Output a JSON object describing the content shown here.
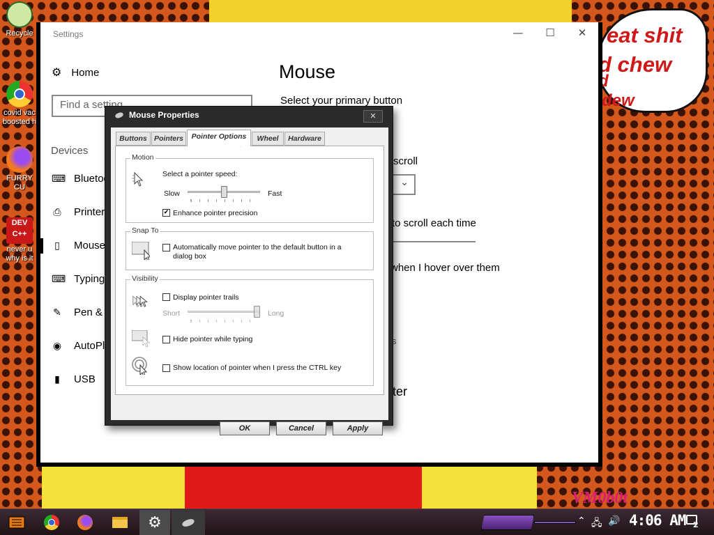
{
  "desktop": {
    "icons": [
      {
        "label": "Recycle"
      },
      {
        "label": "covid vac boosted h"
      },
      {
        "label": "FURRY CU"
      },
      {
        "label": "never u why is it"
      }
    ],
    "speech_bubble": [
      "eat shit",
      "d chew",
      "d",
      "dew"
    ],
    "signature": "VM0b0t"
  },
  "settings": {
    "title": "Settings",
    "controls": {
      "minimize": "—",
      "maximize": "☐",
      "close": "✕"
    },
    "home": "Home",
    "search_placeholder": "Find a setting",
    "section": "Devices",
    "nav": [
      {
        "label": "Bluetooth & other devices",
        "icon": "bluetooth-icon"
      },
      {
        "label": "Printers & scanners",
        "icon": "printer-icon"
      },
      {
        "label": "Mouse",
        "icon": "mouse-icon"
      },
      {
        "label": "Typing",
        "icon": "keyboard-icon"
      },
      {
        "label": "Pen & Windows Ink",
        "icon": "pen-icon"
      },
      {
        "label": "AutoPlay",
        "icon": "autoplay-icon"
      },
      {
        "label": "USB",
        "icon": "usb-icon"
      }
    ],
    "page_title": "Mouse",
    "primary_button_label": "Select your primary button",
    "scroll_label": "scroll",
    "lines_label": "to scroll each time",
    "hover_label": "when I hover over them",
    "s_fragment": "s",
    "bigger_fragment": "tter"
  },
  "dialog": {
    "title": "Mouse Properties",
    "close": "✕",
    "tabs": [
      "Buttons",
      "Pointers",
      "Pointer Options",
      "Wheel",
      "Hardware"
    ],
    "active_tab": "Pointer Options",
    "motion": {
      "label": "Motion",
      "speed_label": "Select a pointer speed:",
      "slow": "Slow",
      "fast": "Fast",
      "speed_value": 0.5,
      "precision_label": "Enhance pointer precision",
      "precision_checked": true
    },
    "snap": {
      "label": "Snap To",
      "text": "Automatically move pointer to the default button in a dialog box",
      "checked": false
    },
    "visibility": {
      "label": "Visibility",
      "trails_label": "Display pointer trails",
      "trails_checked": false,
      "short": "Short",
      "long": "Long",
      "trail_value": 1.0,
      "hide_label": "Hide pointer while typing",
      "hide_checked": false,
      "ctrl_label": "Show location of pointer when I press the CTRL key",
      "ctrl_checked": false
    },
    "buttons": {
      "ok": "OK",
      "cancel": "Cancel",
      "apply": "Apply"
    }
  },
  "taskbar": {
    "clock": "4:06 AM",
    "notifications": "2",
    "tray_icons": [
      "chevron-up-icon",
      "network-icon",
      "volume-icon"
    ]
  },
  "colors": {
    "accent": "#8a4fc4",
    "wallpaper": "#d4581c"
  }
}
